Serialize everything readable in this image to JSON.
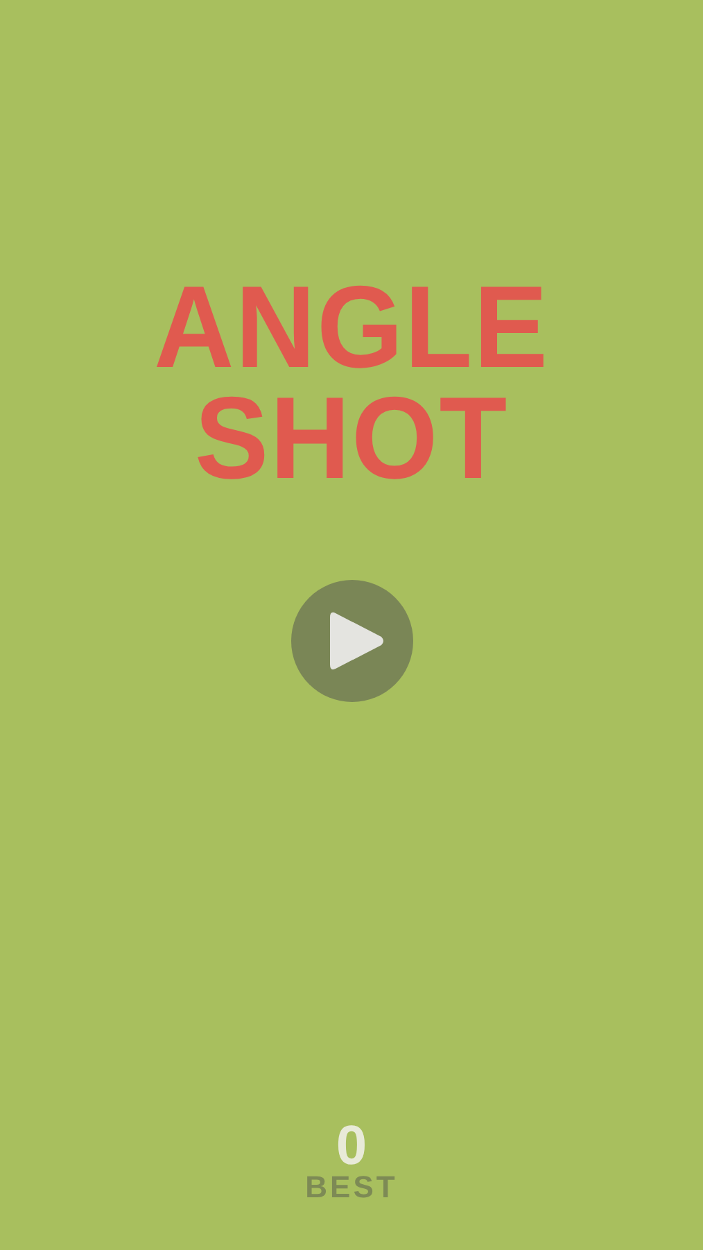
{
  "title_lines": [
    "ANGLE",
    "SHOT"
  ],
  "score": {
    "value": "0",
    "label": "BEST"
  }
}
